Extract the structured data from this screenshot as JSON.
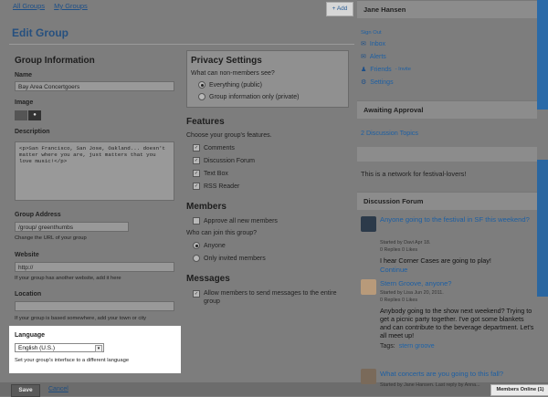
{
  "nav": {
    "all_groups": "All Groups",
    "my_groups": "My Groups",
    "add": "+ Add"
  },
  "page_title": "Edit Group",
  "group_info": {
    "heading": "Group Information",
    "name_label": "Name",
    "name_value": "Bay Area Concertgoers",
    "image_label": "Image",
    "description_label": "Description",
    "description_value": "<p>San Francisco, San Jose, Oakland... doesn't matter where you are, just matters that you love music!</p>",
    "address_label": "Group Address",
    "address_value": "/group/ greenthumbs",
    "address_hint": "Change the URL of your group",
    "website_label": "Website",
    "website_value": "http://",
    "website_hint": "If your group has another website, add it here",
    "location_label": "Location",
    "location_hint": "If your group is based somewhere, add your town or city",
    "language_label": "Language",
    "language_value": "English (U.S.)",
    "language_hint": "Set your group's interface to a different language"
  },
  "buttons": {
    "save": "Save",
    "cancel": "Cancel"
  },
  "privacy": {
    "heading": "Privacy Settings",
    "question": "What can non-members see?",
    "options": [
      "Everything (public)",
      "Group information only (private)"
    ]
  },
  "features": {
    "heading": "Features",
    "prompt": "Choose your group's features.",
    "items": [
      "Comments",
      "Discussion Forum",
      "Text Box",
      "RSS Reader"
    ]
  },
  "members": {
    "heading": "Members",
    "approve": "Approve all new members",
    "question": "Who can join this group?",
    "options": [
      "Anyone",
      "Only invited members"
    ]
  },
  "messages": {
    "heading": "Messages",
    "allow": "Allow members to send messages to the entire group"
  },
  "user_panel": {
    "name": "Jane Hansen",
    "sign_out": "Sign Out",
    "inbox": "Inbox",
    "alerts": "Alerts",
    "friends": "Friends",
    "invite": "- Invite",
    "settings": "Settings"
  },
  "approval": {
    "heading": "Awaiting Approval",
    "item": "2 Discussion Topics"
  },
  "textbox": {
    "text": "This is a network for festival-lovers!"
  },
  "forum": {
    "heading": "Discussion Forum",
    "posts": [
      {
        "title": "Anyone going to the festival in SF this weekend?",
        "meta": "Started by Davi Apr 18.",
        "counts": "0 Replies  0 Likes",
        "body": "I hear Corner Cases are going to play!",
        "more": "Continue"
      },
      {
        "title": "Stern Groove, anyone?",
        "meta": "Started by Lisa Jun 20, 2011.",
        "counts": "0 Replies  0 Likes",
        "body": "Anybody going to the show next weekend? Trying to get a picnic party together. I've got some blankets and can contribute to the beverage department. Let's all meet up!",
        "tags_label": "Tags:",
        "tags": "stern groove"
      },
      {
        "title": "What concerts are you going to this fall?",
        "meta": "Started by Jane Hansen.  Last reply by Anna..."
      }
    ]
  },
  "members_online": "Members Online (1)"
}
